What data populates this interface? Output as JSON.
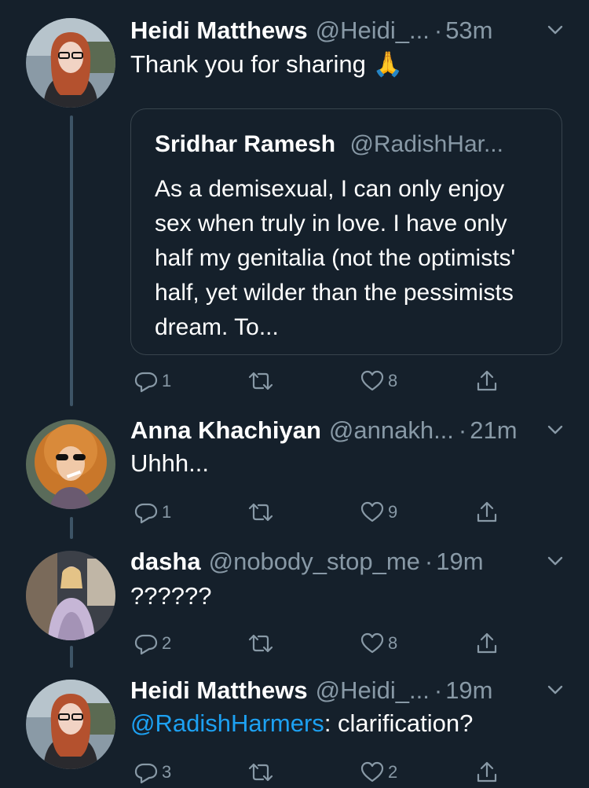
{
  "tweets": [
    {
      "name": "Heidi Matthews",
      "handle": "@Heidi_...",
      "time": "53m",
      "text": "Thank you for sharing 🙏",
      "quote": {
        "name": "Sridhar Ramesh",
        "handle": "@RadishHar...",
        "text": "As a demisexual, I can only enjoy sex when truly in love. I have only half my genitalia (not the optimists' half, yet wilder than the pessimists dream. To..."
      },
      "replies": "1",
      "likes": "8"
    },
    {
      "name": "Anna Khachiyan",
      "handle": "@annakh...",
      "time": "21m",
      "text": "Uhhh...",
      "replies": "1",
      "likes": "9"
    },
    {
      "name": "dasha",
      "handle": "@nobody_stop_me",
      "time": "19m",
      "text": "??????",
      "replies": "2",
      "likes": "8"
    },
    {
      "name": "Heidi Matthews",
      "handle": "@Heidi_...",
      "time": "19m",
      "mention": "@RadishHarmers",
      "text_after_mention": ": clarification?",
      "replies": "3",
      "likes": "2"
    }
  ],
  "colors": {
    "background": "#15202b",
    "muted": "#8899a6",
    "link": "#1da1f2",
    "border": "#38444d"
  },
  "icons": [
    "reply-icon",
    "retweet-icon",
    "like-icon",
    "share-icon",
    "chevron-down-icon"
  ]
}
